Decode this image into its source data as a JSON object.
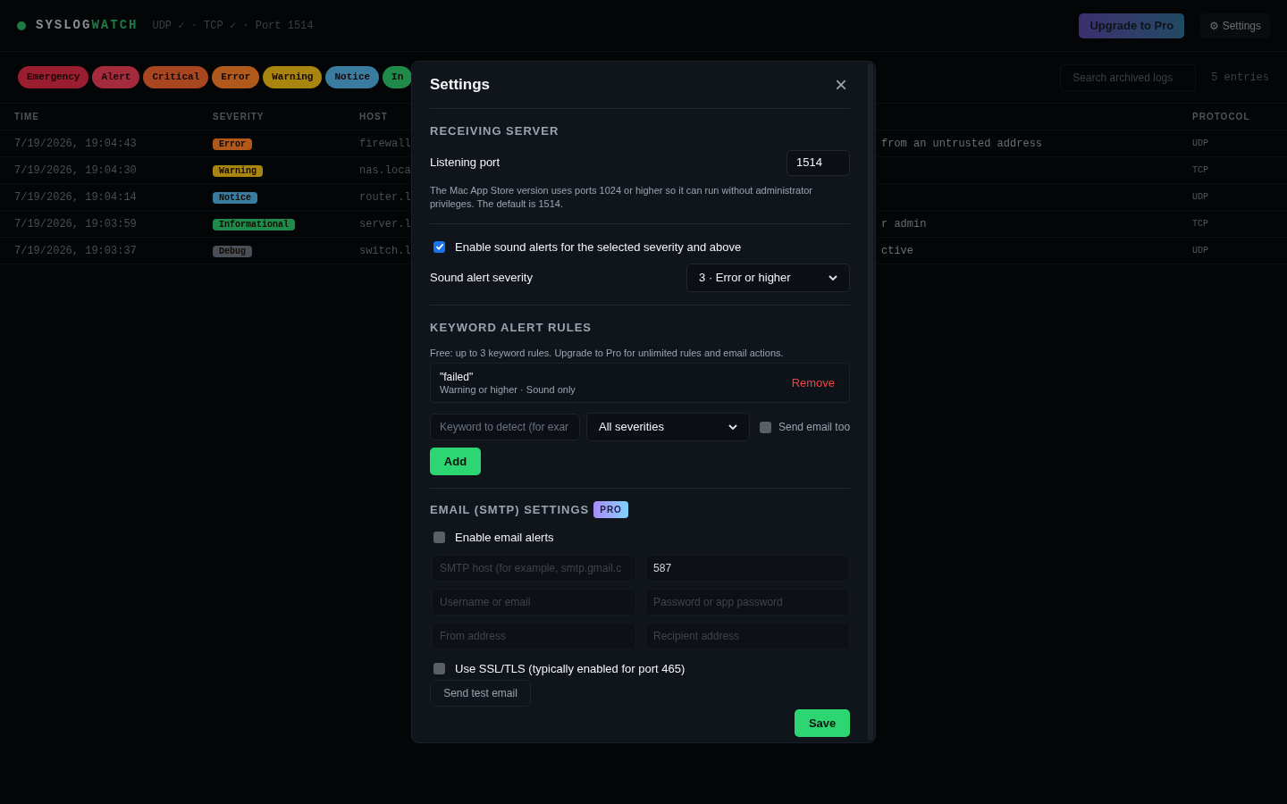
{
  "header": {
    "brand_first": "SYSLOG",
    "brand_second": "WATCH",
    "status": "UDP ✓ · TCP ✓ · Port 1514",
    "upgrade_button": "Upgrade to Pro",
    "settings_button": "⚙ Settings"
  },
  "filters": [
    {
      "label": "Emergency",
      "color": "#9b1d30"
    },
    {
      "label": "Alert",
      "color": "#a32b3c"
    },
    {
      "label": "Critical",
      "color": "#a8461f"
    },
    {
      "label": "Error",
      "color": "#b0591b"
    },
    {
      "label": "Warning",
      "color": "#a8850f"
    },
    {
      "label": "Notice",
      "color": "#3a7ca0"
    },
    {
      "label": "In",
      "color": "#1f8a4a"
    }
  ],
  "search": {
    "placeholder": "Search archived logs"
  },
  "entry_count": "5 entries",
  "table": {
    "columns": [
      "TIME",
      "SEVERITY",
      "HOST",
      "PROTOCOL"
    ],
    "rows": [
      {
        "time": "7/19/2026, 19:04:43",
        "severity": "Error",
        "color": "#b0591b",
        "host": "firewall",
        "message": "from an untrusted address",
        "protocol": "UDP"
      },
      {
        "time": "7/19/2026, 19:04:30",
        "severity": "Warning",
        "color": "#a8850f",
        "host": "nas.loca",
        "message": "",
        "protocol": "TCP"
      },
      {
        "time": "7/19/2026, 19:04:14",
        "severity": "Notice",
        "color": "#3a7ca0",
        "host": "router.l",
        "message": "",
        "protocol": "UDP"
      },
      {
        "time": "7/19/2026, 19:03:59",
        "severity": "Informational",
        "color": "#1f8a4a",
        "host": "server.l",
        "message": "r admin",
        "protocol": "TCP"
      },
      {
        "time": "7/19/2026, 19:03:37",
        "severity": "Debug",
        "color": "#4a4f57",
        "host": "switch.l",
        "message": "ctive",
        "protocol": "UDP"
      }
    ]
  },
  "dialog": {
    "title": "Settings",
    "close": "×",
    "server": {
      "heading": "RECEIVING SERVER",
      "port_label": "Listening port",
      "port_value": "1514",
      "note": "The Mac App Store version uses ports 1024 or higher so it can run without administrator privileges. The default is 1514."
    },
    "sound": {
      "label": "Enable sound alerts for the selected severity and above",
      "checked": true,
      "severity_label": "Sound alert severity",
      "severity_value": "3 · Error or higher"
    },
    "keywords": {
      "heading": "KEYWORD ALERT RULES",
      "note": "Free: up to 3 keyword rules. Upgrade to Pro for unlimited rules and email actions.",
      "rules": [
        {
          "keyword": "\"failed\"",
          "detail": "Warning or higher · Sound only",
          "remove": "Remove"
        }
      ],
      "keyword_placeholder": "Keyword to detect (for exar",
      "severity_value": "All severities",
      "email_label": "Send email too",
      "email_checked": false,
      "add_button": "Add"
    },
    "email": {
      "heading": "EMAIL (SMTP) SETTINGS",
      "badge": "PRO",
      "enable_label": "Enable email alerts",
      "enable_checked": false,
      "fields": [
        {
          "placeholder": "SMTP host (for example, smtp.gmail.c"
        },
        {
          "value": "587"
        },
        {
          "placeholder": "Username or email"
        },
        {
          "placeholder": "Password or app password"
        },
        {
          "placeholder": "From address"
        },
        {
          "placeholder": "Recipient address"
        }
      ],
      "ssl_label": "Use SSL/TLS (typically enabled for port 465)",
      "ssl_checked": false,
      "test_button": "Send test email"
    },
    "save_button": "Save"
  }
}
